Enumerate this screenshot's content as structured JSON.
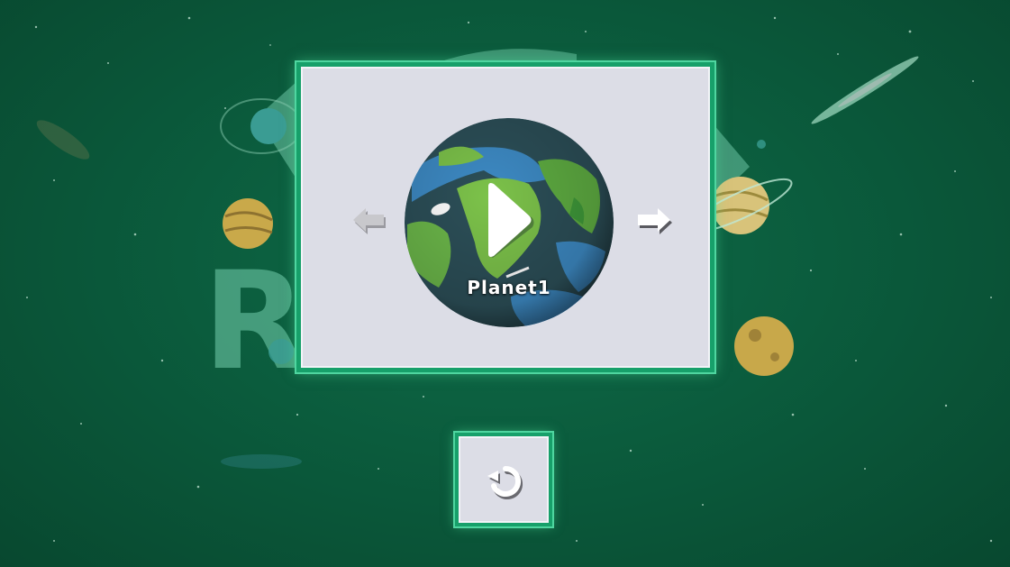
{
  "game": {
    "selected_planet_name": "Planet1"
  },
  "controls": {
    "previous_icon": "arrow-left-icon",
    "next_icon": "arrow-right-icon",
    "play_icon": "play-icon",
    "retry_icon": "refresh-icon"
  },
  "colors": {
    "background": "#0b5c3d",
    "panel": "#dcdde6",
    "panel_border": "#17a06a",
    "panel_glow": "#4fd6a0"
  }
}
